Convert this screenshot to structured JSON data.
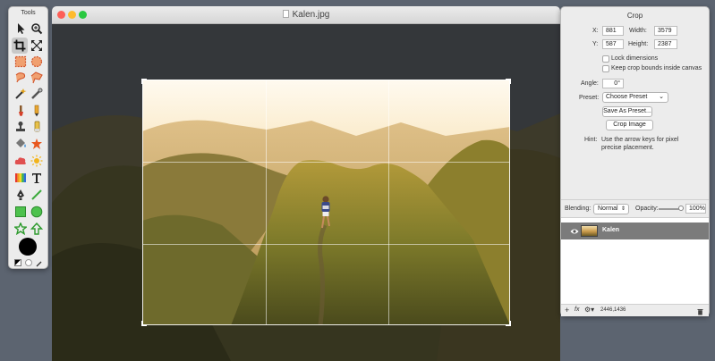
{
  "tools_panel": {
    "title": "Tools",
    "tools": [
      {
        "name": "pointer-tool",
        "icon": "pointer-icon"
      },
      {
        "name": "zoom-tool",
        "icon": "magnifier-icon"
      },
      {
        "name": "crop-tool",
        "icon": "crop-icon",
        "active": true
      },
      {
        "name": "transform-tool",
        "icon": "expand-arrows-icon"
      },
      {
        "name": "rect-select-tool",
        "icon": "rect-select-icon"
      },
      {
        "name": "ellipse-select-tool",
        "icon": "ellipse-select-icon"
      },
      {
        "name": "lasso-tool",
        "icon": "lasso-icon"
      },
      {
        "name": "polygon-lasso-tool",
        "icon": "polygon-lasso-icon"
      },
      {
        "name": "magic-wand-tool",
        "icon": "magic-wand-icon"
      },
      {
        "name": "quick-select-tool",
        "icon": "quick-select-icon"
      },
      {
        "name": "brush-tool",
        "icon": "brush-icon"
      },
      {
        "name": "pencil-tool",
        "icon": "pencil-icon"
      },
      {
        "name": "clone-stamp-tool",
        "icon": "stamp-icon"
      },
      {
        "name": "eraser-tool",
        "icon": "eraser-icon"
      },
      {
        "name": "fill-tool",
        "icon": "bucket-icon"
      },
      {
        "name": "sponge-tool",
        "icon": "sponge-icon"
      },
      {
        "name": "shape-cloud-tool",
        "icon": "cloud-icon"
      },
      {
        "name": "dodge-tool",
        "icon": "sun-icon"
      },
      {
        "name": "gradient-tool",
        "icon": "gradient-icon"
      },
      {
        "name": "text-tool",
        "icon": "text-icon"
      },
      {
        "name": "pen-tool",
        "icon": "pen-icon"
      },
      {
        "name": "line-tool",
        "icon": "line-icon"
      },
      {
        "name": "rectangle-tool",
        "icon": "square-icon"
      },
      {
        "name": "ellipse-tool",
        "icon": "circle-icon"
      },
      {
        "name": "star-tool",
        "icon": "star-icon"
      },
      {
        "name": "arrow-tool",
        "icon": "arrow-up-icon"
      }
    ],
    "foreground_color": "#000000",
    "background_color": "#ffffff"
  },
  "document": {
    "title": "Kalen.jpg"
  },
  "crop_panel": {
    "title": "Crop",
    "x_label": "X:",
    "x_value": "881",
    "y_label": "Y:",
    "y_value": "587",
    "width_label": "Width:",
    "width_value": "3579",
    "height_label": "Height:",
    "height_value": "2387",
    "lock_dimensions_label": "Lock dimensions",
    "keep_bounds_label": "Keep crop bounds inside canvas",
    "angle_label": "Angle:",
    "angle_value": "0°",
    "preset_label": "Preset:",
    "preset_value": "Choose Preset",
    "save_preset_label": "Save As Preset...",
    "crop_image_label": "Crop Image",
    "hint_label": "Hint:",
    "hint_text_line1": "Use the arrow keys for pixel",
    "hint_text_line2": "precise placement."
  },
  "layers_panel": {
    "blending_label": "Blending:",
    "blending_value": "Normal",
    "opacity_label": "Opacity:",
    "opacity_value": "100%",
    "opacity_level": 1.0,
    "layers": [
      {
        "name": "Kalen",
        "visible": true,
        "selected": true
      }
    ],
    "add_symbol": "+",
    "fx_label": "fx",
    "coordinates": "2446,1436"
  },
  "colors": {
    "accent_red": "#fd5f57",
    "accent_yellow": "#febb2e",
    "accent_green": "#29c840",
    "selected_layer": "#7b7b7b"
  }
}
